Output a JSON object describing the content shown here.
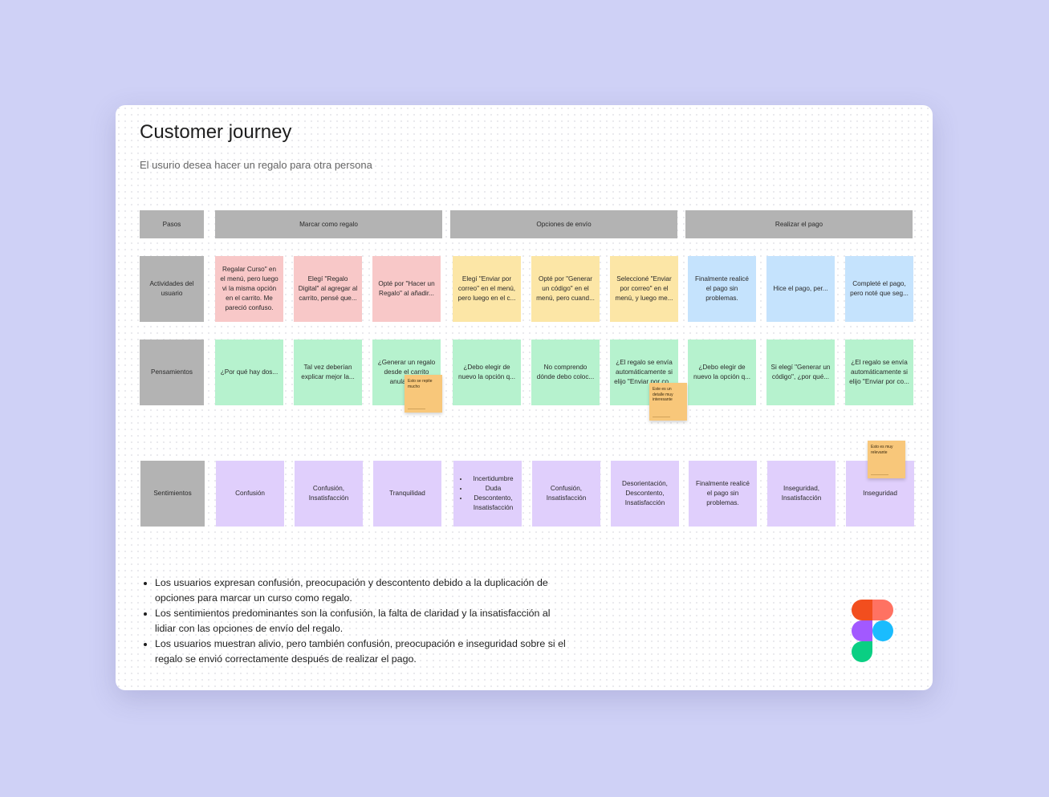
{
  "board": {
    "title": "Customer journey",
    "subtitle": "El usurio desea hacer un regalo para otra persona"
  },
  "header_row": {
    "label": "Pasos",
    "stages": [
      "Marcar como regalo",
      "Opciones de envío",
      "Realizar el pago"
    ]
  },
  "rows": {
    "actividades": {
      "label": "Actividades del usuario",
      "cells": [
        "Regalar Curso\" en el menú, pero luego vi la misma opción en el carrito. Me pareció confuso.",
        "Elegí \"Regalo Digital\" al agregar al carrito, pensé que...",
        "Opté por \"Hacer un Regalo\" al añadir...",
        "Elegí \"Enviar por correo\" en el menú, pero luego en el c...",
        "Opté por \"Generar un código\" en el menú, pero cuand...",
        "Seleccioné \"Enviar por correo\" en el menú, y luego me...",
        "Finalmente realicé el pago sin problemas.",
        "Hice el pago, per...",
        "Completé el pago, pero noté que seg..."
      ]
    },
    "pensamientos": {
      "label": "Pensamientos",
      "cells": [
        "¿Por qué hay dos...",
        "Tal vez deberían explicar mejor la...",
        "¿Generar un regalo desde el carrito anula el c...",
        "¿Debo elegir de nuevo la opción q...",
        "No comprendo dónde debo coloc...",
        "¿El regalo se envía automáticamente si elijo \"Enviar por co...",
        "¿Debo elegir de nuevo la opción q...",
        "Si elegí \"Generar un código\", ¿por qué...",
        "¿El regalo se envía automáticamente si elijo \"Enviar por co..."
      ]
    },
    "sentimientos": {
      "label": "Sentimientos",
      "cells": [
        "Confusión",
        "Confusión, Insatisfacción",
        "Tranquilidad",
        [
          "Incertidumbre",
          "Duda",
          "Descontento, Insatisfacción"
        ],
        "Confusión, Insatisfacción",
        "Desorientación, Descontento, Insatisfacción",
        "Finalmente realicé el pago sin problemas.",
        "Inseguridad, Insatisfacción",
        "Inseguridad"
      ]
    }
  },
  "sticky_notes": [
    "Esto se repite mucho",
    "Este es un detalle muy interesante",
    "Esto es muy relevante"
  ],
  "findings": [
    "Los usuarios expresan confusión, preocupación y descontento debido a la duplicación de opciones para marcar un curso como regalo.",
    "Los sentimientos predominantes son la confusión, la falta de claridad y la insatisfacción al lidiar con las opciones de envío del regalo.",
    "Los usuarios muestran alivio, pero también confusión, preocupación e inseguridad sobre si el regalo se envió correctamente después de realizar el pago."
  ],
  "colors": {
    "background": "#cfd1f6",
    "header_gray": "#b3b3b3",
    "stage_red": "#f8c8c8",
    "stage_yellow": "#fce6a6",
    "stage_blue": "#c5e3fd",
    "thoughts_green": "#b6f2ce",
    "feelings_purple": "#e0cffc",
    "sticky_note": "#f8c77a"
  },
  "icons": [
    "figma-logo-icon"
  ]
}
